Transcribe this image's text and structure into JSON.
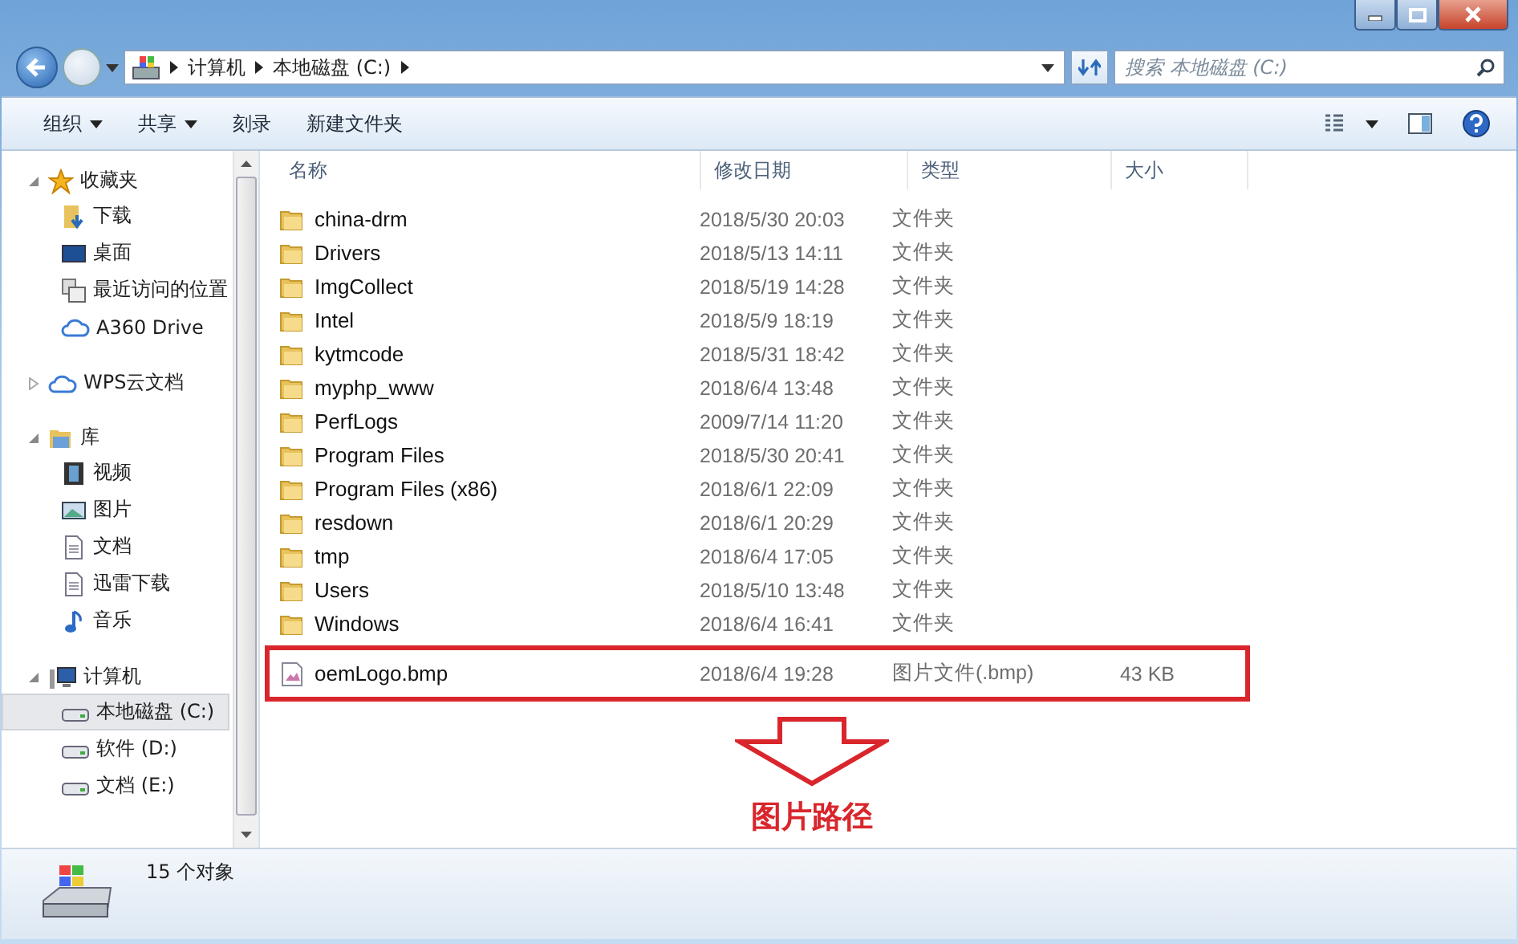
{
  "address_bar": {
    "crumbs": [
      "计算机",
      "本地磁盘 (C:)"
    ],
    "search_placeholder": "搜索 本地磁盘 (C:)"
  },
  "toolbar": [
    {
      "label": "组织",
      "dropdown": true
    },
    {
      "label": "共享",
      "dropdown": true
    },
    {
      "label": "刻录",
      "dropdown": false
    },
    {
      "label": "新建文件夹",
      "dropdown": false
    }
  ],
  "sidebar": [
    {
      "label": "收藏夹",
      "kind": "star",
      "expanded": true,
      "children": [
        {
          "label": "下载",
          "kind": "download",
          "selected": false
        },
        {
          "label": "桌面",
          "kind": "desktop",
          "selected": false
        },
        {
          "label": "最近访问的位置",
          "kind": "recent",
          "selected": false
        },
        {
          "label": "A360 Drive",
          "kind": "cloud",
          "selected": false
        }
      ]
    },
    {
      "label": "WPS云文档",
      "kind": "cloud",
      "expanded": false
    },
    {
      "label": "库",
      "kind": "library",
      "expanded": true,
      "children": [
        {
          "label": "视频",
          "kind": "video",
          "selected": false
        },
        {
          "label": "图片",
          "kind": "picture",
          "selected": false
        },
        {
          "label": "文档",
          "kind": "document",
          "selected": false
        },
        {
          "label": "迅雷下载",
          "kind": "document",
          "selected": false
        },
        {
          "label": "音乐",
          "kind": "music",
          "selected": false
        }
      ]
    },
    {
      "label": "计算机",
      "kind": "computer",
      "expanded": true,
      "children": [
        {
          "label": "本地磁盘 (C:)",
          "kind": "drive",
          "selected": true
        },
        {
          "label": "软件 (D:)",
          "kind": "drive",
          "selected": false
        },
        {
          "label": "文档 (E:)",
          "kind": "drive",
          "selected": false
        }
      ]
    }
  ],
  "table": {
    "columns": [
      "名称",
      "修改日期",
      "类型",
      "大小"
    ],
    "rows": [
      {
        "name": "china-drm",
        "date": "2018/5/30 20:03",
        "type": "文件夹",
        "kind": "folder",
        "highlighted": false
      },
      {
        "name": "Drivers",
        "date": "2018/5/13 14:11",
        "type": "文件夹",
        "kind": "folder",
        "highlighted": false
      },
      {
        "name": "ImgCollect",
        "date": "2018/5/19 14:28",
        "type": "文件夹",
        "kind": "folder",
        "highlighted": false
      },
      {
        "name": "Intel",
        "date": "2018/5/9 18:19",
        "type": "文件夹",
        "kind": "folder",
        "highlighted": false
      },
      {
        "name": "kytmcode",
        "date": "2018/5/31 18:42",
        "type": "文件夹",
        "kind": "folder",
        "highlighted": false
      },
      {
        "name": "myphp_www",
        "date": "2018/6/4 13:48",
        "type": "文件夹",
        "kind": "folder",
        "highlighted": false
      },
      {
        "name": "PerfLogs",
        "date": "2009/7/14 11:20",
        "type": "文件夹",
        "kind": "folder",
        "highlighted": false
      },
      {
        "name": "Program Files",
        "date": "2018/5/30 20:41",
        "type": "文件夹",
        "kind": "folder",
        "highlighted": false
      },
      {
        "name": "Program Files (x86)",
        "date": "2018/6/1 22:09",
        "type": "文件夹",
        "kind": "folder",
        "highlighted": false
      },
      {
        "name": "resdown",
        "date": "2018/6/1 20:29",
        "type": "文件夹",
        "kind": "folder",
        "highlighted": false
      },
      {
        "name": "tmp",
        "date": "2018/6/4 17:05",
        "type": "文件夹",
        "kind": "folder",
        "highlighted": false
      },
      {
        "name": "Users",
        "date": "2018/5/10 13:48",
        "type": "文件夹",
        "kind": "folder",
        "highlighted": false
      },
      {
        "name": "Windows",
        "date": "2018/6/4 16:41",
        "type": "文件夹",
        "kind": "folder",
        "highlighted": false
      },
      {
        "name": "oemLogo.bmp",
        "date": "2018/6/4 19:28",
        "type": "图片文件(.bmp)",
        "size": "43 KB",
        "kind": "image",
        "highlighted": true
      }
    ]
  },
  "callout": "图片路径",
  "status_bar": {
    "text": "15 个对象"
  }
}
